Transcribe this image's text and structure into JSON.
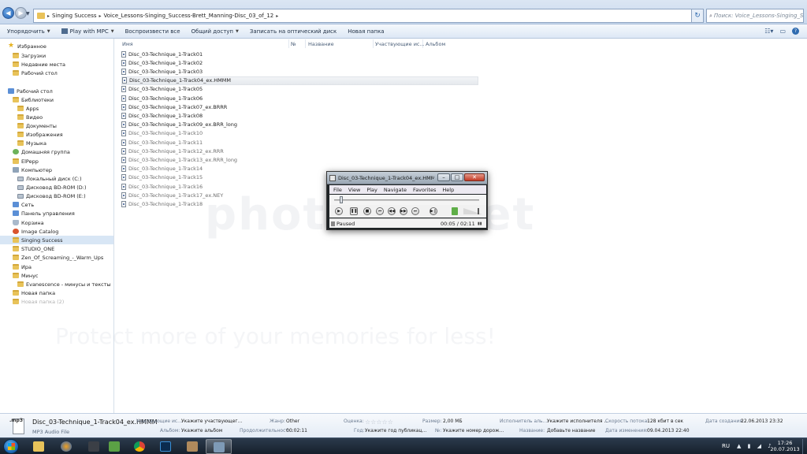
{
  "address": {
    "crumbs": [
      "Singing Success",
      "Voice_Lessons-Singing_Success-Brett_Manning-Disc_03_of_12"
    ],
    "search_placeholder": "Поиск: Voice_Lessons-Singing_Success..."
  },
  "toolbar": {
    "organize": "Упорядочить",
    "play_with": "Play with MPC",
    "play_all": "Воспроизвести все",
    "share": "Общий доступ",
    "burn": "Записать на оптический диск",
    "new_folder": "Новая папка"
  },
  "nav": [
    {
      "label": "Избранное",
      "icon": "star-icon"
    },
    {
      "label": "Загрузки",
      "icon": "folder-icon"
    },
    {
      "label": "Недавние места",
      "icon": "folder-icon"
    },
    {
      "label": "Рабочий стол",
      "icon": "folder-icon"
    },
    {
      "label": "Рабочий стол",
      "icon": "desktop-icon"
    },
    {
      "label": "Библиотеки",
      "icon": "library-icon"
    },
    {
      "label": "Apps",
      "icon": "folder-icon"
    },
    {
      "label": "Видео",
      "icon": "folder-icon"
    },
    {
      "label": "Документы",
      "icon": "folder-icon"
    },
    {
      "label": "Изображения",
      "icon": "folder-icon"
    },
    {
      "label": "Музыка",
      "icon": "folder-icon"
    },
    {
      "label": "Домашняя группа",
      "icon": "homegroup-icon"
    },
    {
      "label": "ElPepp",
      "icon": "folder-icon"
    },
    {
      "label": "Компьютер",
      "icon": "computer-icon"
    },
    {
      "label": "Локальный диск (C:)",
      "icon": "drive-icon"
    },
    {
      "label": "Дисковод BD-ROM (D:)",
      "icon": "drive-icon"
    },
    {
      "label": "Дисковод BD-ROM (E:)",
      "icon": "drive-icon"
    },
    {
      "label": "Сеть",
      "icon": "network-icon"
    },
    {
      "label": "Панель управления",
      "icon": "control-panel-icon"
    },
    {
      "label": "Корзина",
      "icon": "recycle-bin-icon"
    },
    {
      "label": "Image Catalog",
      "icon": "image-catalog-icon"
    },
    {
      "label": "Singing Success",
      "icon": "folder-icon"
    },
    {
      "label": "STUDIO_ONE",
      "icon": "folder-icon"
    },
    {
      "label": "Zen_Of_Screaming_-_Warm_Ups",
      "icon": "folder-icon"
    },
    {
      "label": "Ира",
      "icon": "folder-icon"
    },
    {
      "label": "Минус",
      "icon": "folder-icon"
    },
    {
      "label": "Evanescence - минусы и тексты",
      "icon": "folder-icon"
    },
    {
      "label": "Новая папка",
      "icon": "folder-icon"
    },
    {
      "label": "Новая папка (2)",
      "icon": "folder-icon"
    }
  ],
  "columns": [
    "Имя",
    "№",
    "Название",
    "Участвующие ис...",
    "Альбом"
  ],
  "files": [
    "Disc_03-Technique_1-Track01",
    "Disc_03-Technique_1-Track02",
    "Disc_03-Technique_1-Track03",
    "Disc_03-Technique_1-Track04_ex.HMMM",
    "Disc_03-Technique_1-Track05",
    "Disc_03-Technique_1-Track06",
    "Disc_03-Technique_1-Track07_ex.BRRR",
    "Disc_03-Technique_1-Track08",
    "Disc_03-Technique_1-Track09_ex.BRR_long",
    "Disc_03-Technique_1-Track10",
    "Disc_03-Technique_1-Track11",
    "Disc_03-Technique_1-Track12_ex.RRR",
    "Disc_03-Technique_1-Track13_ex.RRR_long",
    "Disc_03-Technique_1-Track14",
    "Disc_03-Technique_1-Track15",
    "Disc_03-Technique_1-Track16",
    "Disc_03-Technique_1-Track17_ex.NEY",
    "Disc_03-Technique_1-Track18"
  ],
  "mpc": {
    "title": "Disc_03-Technique_1-Track04_ex.HMMM.m...",
    "menu": [
      "File",
      "View",
      "Play",
      "Navigate",
      "Favorites",
      "Help"
    ],
    "status": "Paused",
    "time": "00:05 / 02:11",
    "seek_fraction": 0.038,
    "volume_fraction": 0.75
  },
  "watermark": {
    "big": "photobucket",
    "small": "Protect more of your memories for less!"
  },
  "details": {
    "name": "Disc_03-Technique_1-Track04_ex.HMMM",
    "type": "MP3 Audio File",
    "thumb_text": ".mp3",
    "fields": [
      {
        "label": "Участвующие ис...",
        "value": "Укажите участвующег..."
      },
      {
        "label": "Альбом:",
        "value": "Укажите альбом"
      },
      {
        "label": "Жанр:",
        "value": "Other"
      },
      {
        "label": "Продолжительност...",
        "value": "00:02:11"
      },
      {
        "label": "Оценка:",
        "value": ""
      },
      {
        "label": "Год:",
        "value": "Укажите год публикац..."
      },
      {
        "label": "Размер:",
        "value": "2,00 МБ"
      },
      {
        "label": "№:",
        "value": "Укажите номер дорож..."
      },
      {
        "label": "Исполнитель аль...",
        "value": "Укажите исполнителя ..."
      },
      {
        "label": "Название:",
        "value": "Добавьте название"
      },
      {
        "label": "Скорость потока:",
        "value": "128 кбит в сек"
      },
      {
        "label": "Дата изменения:",
        "value": "09.04.2013 22:40"
      },
      {
        "label": "Дата создания:",
        "value": "22.06.2013 23:32"
      }
    ],
    "rating": "☆☆☆☆☆"
  },
  "taskbar": {
    "lang": "RU",
    "time": "17:26",
    "date": "20.07.2013"
  }
}
